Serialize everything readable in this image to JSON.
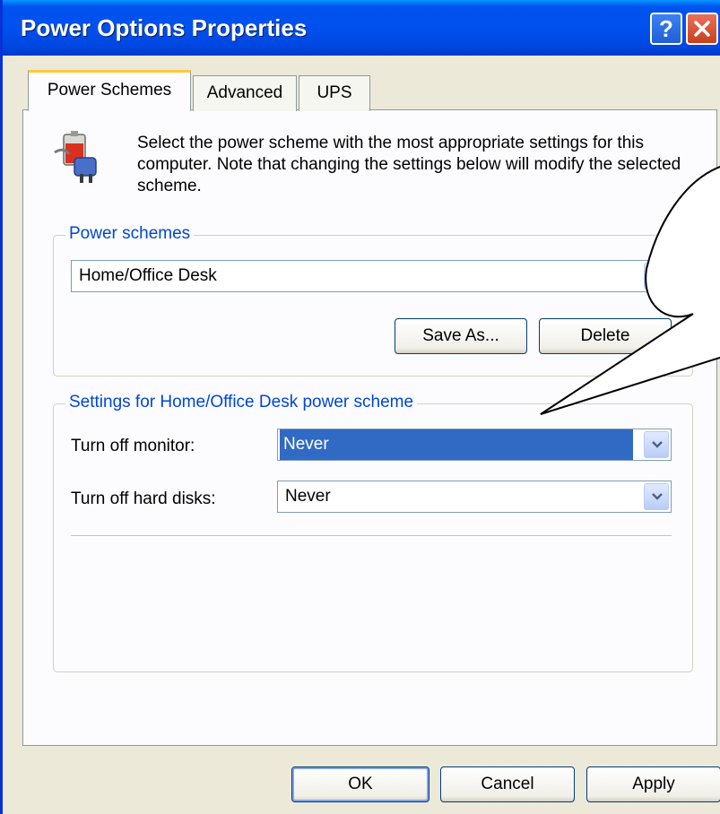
{
  "window": {
    "title": "Power Options Properties",
    "help_label": "?",
    "accent": "#0054e3"
  },
  "tabs": [
    {
      "label": "Power Schemes",
      "active": true
    },
    {
      "label": "Advanced",
      "active": false
    },
    {
      "label": "UPS",
      "active": false
    }
  ],
  "description": "Select the power scheme with the most appropriate settings for this computer. Note that changing the settings below will modify the selected scheme.",
  "power_schemes": {
    "group_label": "Power schemes",
    "selected": "Home/Office Desk",
    "save_as_label": "Save As...",
    "delete_label": "Delete"
  },
  "settings": {
    "group_label": "Settings for Home/Office Desk power scheme",
    "monitor_label": "Turn off monitor:",
    "monitor_value": "Never",
    "disks_label": "Turn off hard disks:",
    "disks_value": "Never"
  },
  "footer": {
    "ok_label": "OK",
    "cancel_label": "Cancel",
    "apply_label": "Apply"
  },
  "icons": {
    "app": "power-plug-battery-icon",
    "dropdown": "chevron-down-icon",
    "close": "close-icon",
    "help": "help-icon"
  }
}
